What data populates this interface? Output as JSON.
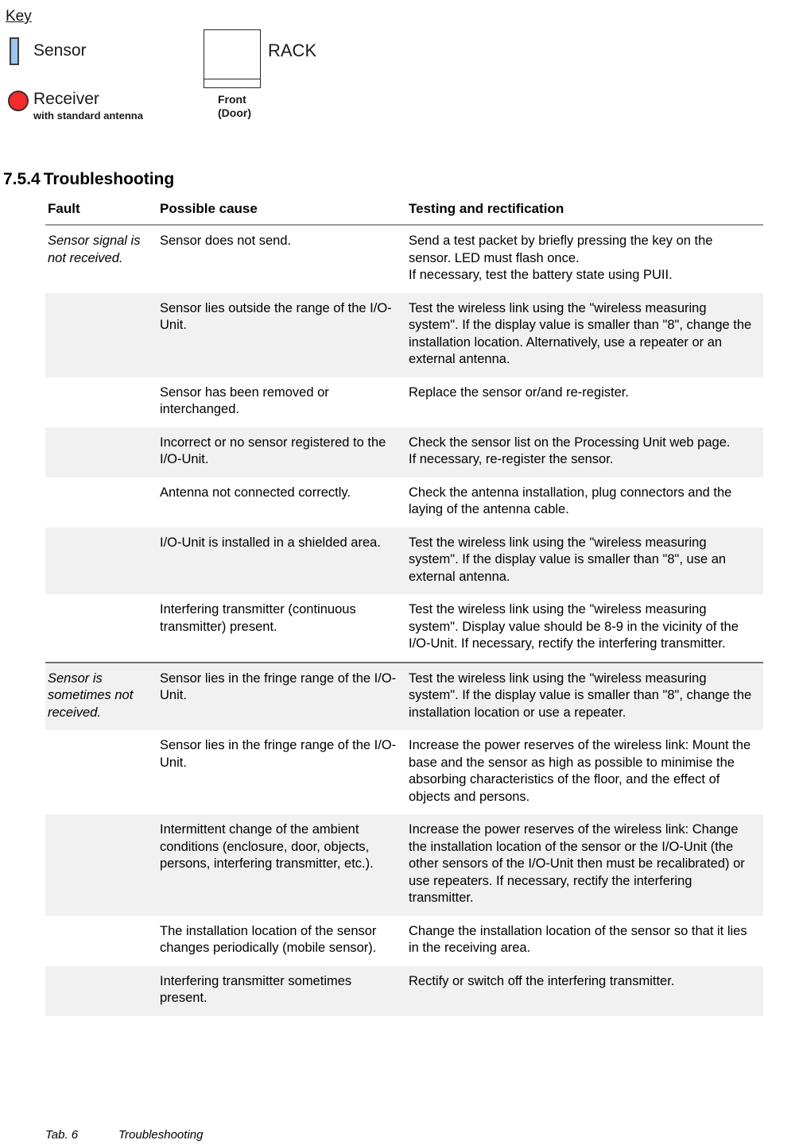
{
  "legend": {
    "title": "Key",
    "sensor_label": "Sensor",
    "sensor_color": "#9dc6f0",
    "receiver_label": "Receiver",
    "receiver_sublabel": "with standard antenna",
    "receiver_color": "#f52a2a",
    "rack_name": "RACK",
    "rack_caption_line1": "Front",
    "rack_caption_line2": "(Door)"
  },
  "section": {
    "number": "7.5.4",
    "title": "Troubleshooting"
  },
  "table": {
    "headers": [
      "Fault",
      "Possible cause",
      "Testing and rectification"
    ],
    "rows": [
      {
        "group_start": true,
        "shaded": false,
        "fault": "Sensor signal is not received.",
        "cause": "Sensor does not send.",
        "testing": "Send a test packet by briefly pressing the key on the sensor. LED must flash once.\nIf necessary, test the battery state using PUII."
      },
      {
        "group_start": false,
        "shaded": true,
        "fault": "",
        "cause": "Sensor lies outside the range of the I/O-Unit.",
        "testing": "Test the wireless link using the \"wireless measuring system\". If the display value is smaller than \"8\", change the installation location. Alternatively, use a repeater or an external antenna."
      },
      {
        "group_start": false,
        "shaded": false,
        "fault": "",
        "cause": "Sensor has been removed or interchanged.",
        "testing": "Replace the sensor or/and re-register."
      },
      {
        "group_start": false,
        "shaded": true,
        "fault": "",
        "cause": "Incorrect or no sensor registered to the I/O-Unit.",
        "testing": "Check the sensor list on the Processing Unit web page.\nIf necessary, re-register the sensor."
      },
      {
        "group_start": false,
        "shaded": false,
        "fault": "",
        "cause": "Antenna not connected correctly.",
        "testing": "Check the antenna installation, plug connectors and the laying of the antenna cable."
      },
      {
        "group_start": false,
        "shaded": true,
        "fault": "",
        "cause": "I/O-Unit is installed in a shielded area.",
        "testing": "Test the wireless link using the \"wireless measuring system\". If the display value is smaller than \"8\", use an external antenna."
      },
      {
        "group_start": false,
        "shaded": false,
        "fault": "",
        "cause": "Interfering transmitter (continuous transmitter) present.",
        "testing": "Test the wireless link using the \"wireless measuring system\". Display value should be 8-9 in the vicinity of the I/O-Unit. If necessary, rectify the interfering transmitter."
      },
      {
        "group_start": true,
        "shaded": true,
        "fault": "Sensor is sometimes not received.",
        "cause": "Sensor lies in the fringe range of the I/O-Unit.",
        "testing": "Test the wireless link using the \"wireless measuring system\". If the display value is smaller than \"8\", change the installation location or use a repeater."
      },
      {
        "group_start": false,
        "shaded": false,
        "fault": "",
        "cause": "Sensor lies in the fringe range of the I/O-Unit.",
        "testing": "Increase the power reserves of the wireless link: Mount the base and the sensor as high as possible to minimise the absorbing characteristics of the floor, and the effect of objects and persons."
      },
      {
        "group_start": false,
        "shaded": true,
        "fault": "",
        "cause": "Intermittent change of the ambient conditions (enclosure, door, objects, persons, interfering transmitter, etc.).",
        "testing": "Increase the power reserves of the wireless link: Change the installation location of the sensor or the I/O-Unit (the other sensors of the I/O-Unit then must be recalibrated) or use repeaters. If necessary, rectify the interfering transmitter."
      },
      {
        "group_start": false,
        "shaded": false,
        "fault": "",
        "cause": "The installation location of the sensor changes periodically (mobile sensor).",
        "testing": "Change the installation location of the sensor so that it lies in the receiving area."
      },
      {
        "group_start": false,
        "shaded": true,
        "fault": "",
        "cause": "Interfering transmitter sometimes present.",
        "testing": "Rectify or switch off the interfering transmitter."
      }
    ]
  },
  "caption": {
    "number": "Tab. 6",
    "text": "Troubleshooting"
  }
}
